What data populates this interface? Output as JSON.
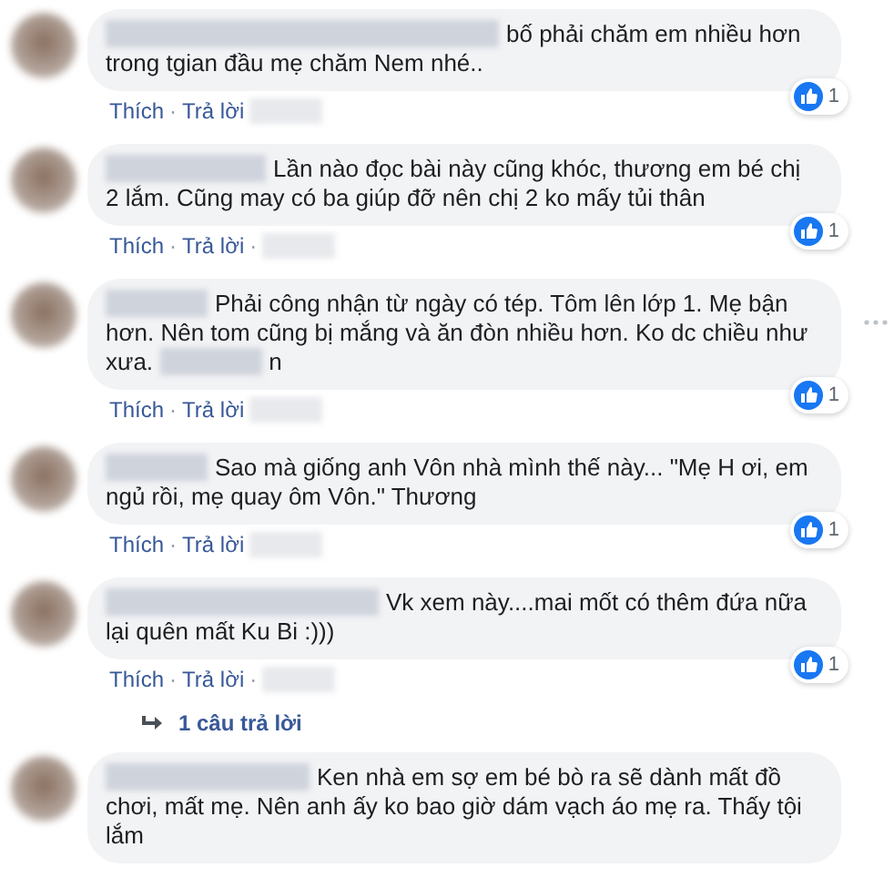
{
  "comments": [
    {
      "text": "bố phải chăm em nhiều hơn trong tgian đầu mẹ chăm Nem nhé..",
      "likes": "1",
      "actions": [
        "Thích",
        "·",
        "Trả lời"
      ]
    },
    {
      "text": "Lần nào đọc bài này cũng khóc, thương em bé chị 2 lắm. Cũng may có ba giúp đỡ nên chị 2 ko mấy tủi thân",
      "likes": "1",
      "actions": [
        "Thích",
        "·",
        "Trả lời",
        "·"
      ]
    },
    {
      "text": "Phải công nhận từ ngày có tép. Tôm lên lớp 1. Mẹ bận hơn. Nên tom cũng bị mắng và ăn đòn nhiều hơn. Ko dc chiều như xưa.",
      "text_after_blur": "n",
      "likes": "1",
      "more_menu": true,
      "actions": [
        "Thích",
        "·",
        "Trả lời"
      ]
    },
    {
      "text": "Sao mà giống anh Vôn nhà mình thế này... \"Mẹ H ơi, em ngủ rồi, mẹ quay ôm Vôn.\" Thương",
      "likes": "1",
      "actions": [
        "Thích",
        "·",
        "Trả lời"
      ]
    },
    {
      "text": "Vk xem này....mai mốt có thêm đứa nữa lại quên mất Ku Bi :)))",
      "likes": "1",
      "actions": [
        "Thích",
        "·",
        "Trả lời",
        "·"
      ],
      "replies": "1 câu trả lời"
    },
    {
      "text": "Ken nhà em sợ em bé bò ra sẽ dành mất đồ chơi, mất mẹ. Nên anh ấy ko bao giờ dám vạch áo mẹ ra. Thấy tội lắm"
    }
  ]
}
